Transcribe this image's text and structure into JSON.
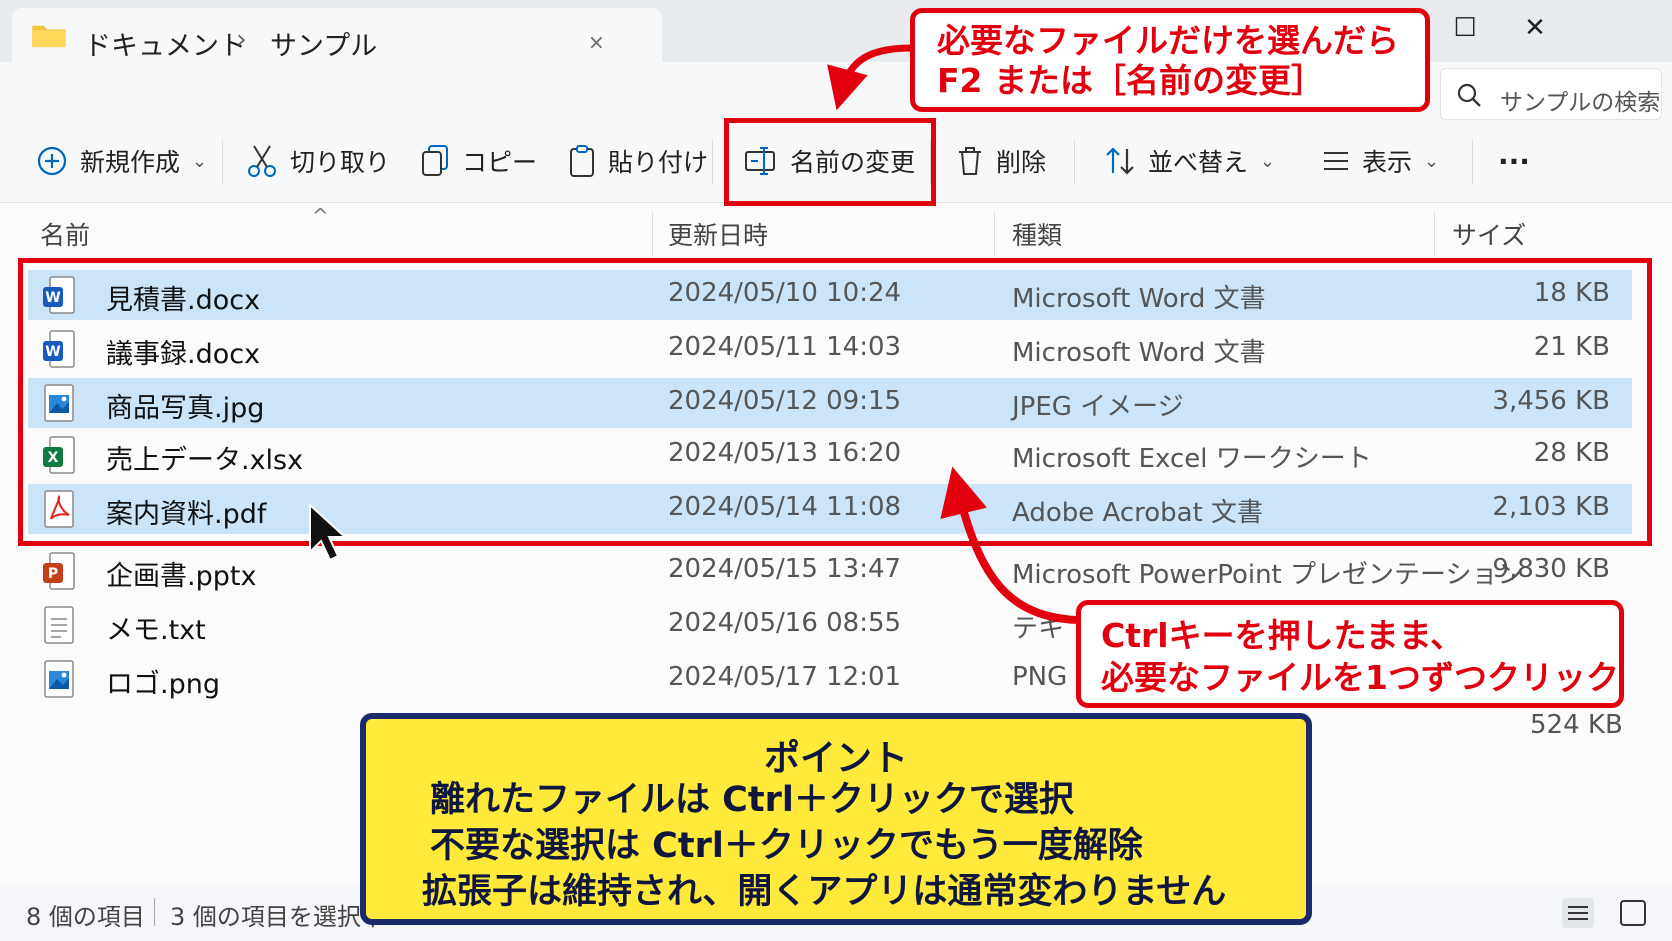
{
  "window": {
    "tab_breadcrumb": [
      "ドキュメント",
      "›",
      "サンプル"
    ],
    "tab_close": "×",
    "controls": [
      "—",
      "☐",
      "✕"
    ],
    "search_placeholder": "サンプルの検索"
  },
  "toolbar": {
    "new_label": "新規作成",
    "cut_label": "切り取り",
    "copy_label": "コピー",
    "paste_label": "貼り付け",
    "rename_label": "名前の変更",
    "delete_label": "削除",
    "sort_label": "並べ替え",
    "view_label": "表示",
    "more_label": "···"
  },
  "columns": [
    "名前",
    "更新日時",
    "種類",
    "サイズ"
  ],
  "files": [
    {
      "name": "見積書.docx",
      "date": "2024/05/10  10:24",
      "type": "Microsoft Word 文書",
      "size": "18 KB",
      "icon": "word-icon",
      "selected": true
    },
    {
      "name": "議事録.docx",
      "date": "2024/05/11  14:03",
      "type": "Microsoft Word 文書",
      "size": "21 KB",
      "icon": "word-icon",
      "selected": false
    },
    {
      "name": "商品写真.jpg",
      "date": "2024/05/12  09:15",
      "type": "JPEG イメージ",
      "size": "3,456 KB",
      "icon": "image-icon",
      "selected": true
    },
    {
      "name": "売上データ.xlsx",
      "date": "2024/05/13  16:20",
      "type": "Microsoft Excel ワークシート",
      "size": "28 KB",
      "icon": "excel-icon",
      "selected": false
    },
    {
      "name": "案内資料.pdf",
      "date": "2024/05/14  11:08",
      "type": "Adobe Acrobat 文書",
      "size": "2,103 KB",
      "icon": "pdf-icon",
      "selected": true
    },
    {
      "name": "企画書.pptx",
      "date": "2024/05/15  13:47",
      "type": "Microsoft PowerPoint プレゼンテーション",
      "size": "9,830 KB",
      "icon": "powerpoint-icon",
      "selected": false
    },
    {
      "name": "メモ.txt",
      "date": "2024/05/16  08:55",
      "type": "テキ",
      "size": "",
      "icon": "text-file-icon",
      "selected": false
    },
    {
      "name": "ロゴ.png",
      "date": "2024/05/17  12:01",
      "type": "PNG",
      "size": "",
      "icon": "image-icon",
      "selected": false
    }
  ],
  "orphan_size": "524 KB",
  "status": {
    "count": "8 個の項目",
    "selected": "3 個の項目を選択中"
  },
  "callouts": {
    "rename_tip": [
      "必要なファイルだけを選んだら",
      "F2 または［名前の変更］"
    ],
    "ctrl_tip": [
      "Ctrlキーを押したまま、",
      "必要なファイルを1つずつクリック"
    ],
    "point_title": "ポイント",
    "point_lines": [
      "離れたファイルは Ctrl＋クリックで選択",
      "不要な選択は Ctrl＋クリックでもう一度解除",
      "拡張子は維持され、開くアプリは通常変わりません"
    ]
  },
  "colors": {
    "accent_red": "#e2000f",
    "selection": "#cce4f7",
    "point_bg": "#ffe93a",
    "point_border": "#1c2a6b"
  }
}
